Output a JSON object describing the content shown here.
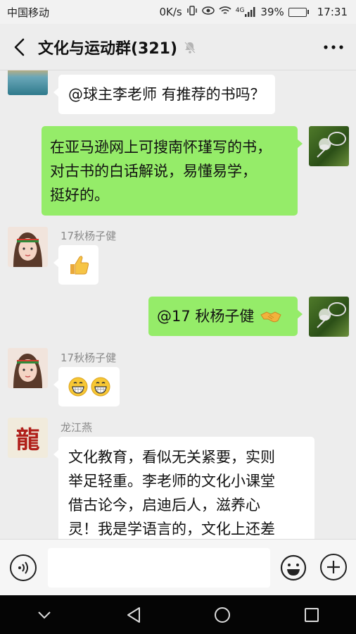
{
  "status_bar": {
    "carrier": "中国移动",
    "net_speed": "0K/s",
    "network_type": "4G",
    "battery": "39%",
    "battery_level": 0.39,
    "time": "17:31"
  },
  "header": {
    "title": "文化与运动群(321)",
    "icons": [
      "back-arrow-icon",
      "mute-bell-icon",
      "more-dots-icon"
    ]
  },
  "messages": [
    {
      "side": "left",
      "sender": "",
      "avatar": "beach",
      "text": "@球主李老师  有推荐的书吗？"
    },
    {
      "side": "right",
      "sender": "",
      "avatar": "badminton",
      "lines": [
        "在亚马逊网上可搜南怀瑾写的书，",
        "对古书的白话解说，易懂易学，",
        "挺好的。"
      ]
    },
    {
      "side": "left",
      "sender": "17秋杨子健",
      "avatar": "girl",
      "emoji": "thumbs-up"
    },
    {
      "side": "right",
      "sender": "",
      "avatar": "badminton",
      "text": "@17 秋杨子健",
      "emoji": "handshake"
    },
    {
      "side": "left",
      "sender": "17秋杨子健",
      "avatar": "girl",
      "emoji": "grin-grin"
    },
    {
      "side": "left",
      "sender": "龙江燕",
      "avatar": "dragon",
      "avatar_text": "龍",
      "lines": [
        "文化教育，看似无关紧要，实则",
        "举足轻重。李老师的文化小课堂",
        "借古论今，启迪后人，滋养心",
        "灵！我是学语言的，文化上还差"
      ]
    }
  ],
  "input_bar": {
    "placeholder": "",
    "icons": [
      "voice-icon",
      "emoji-icon",
      "plus-icon"
    ]
  },
  "nav_bar": {
    "icons": [
      "nav-down-icon",
      "nav-back-icon",
      "nav-home-icon",
      "nav-recents-icon"
    ]
  },
  "colors": {
    "green_bubble": "#95ec69",
    "chat_background": "#ededed",
    "battery_fill": "#3fb73f"
  }
}
